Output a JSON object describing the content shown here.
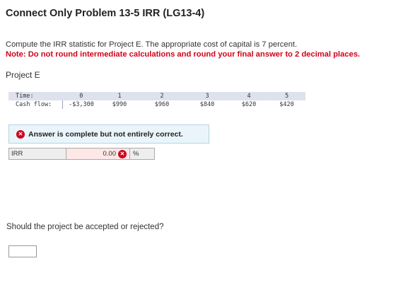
{
  "header": {
    "title": "Connect Only Problem 13-5 IRR (LG13-4)"
  },
  "instructions": {
    "prompt": "Compute the IRR statistic for Project E. The appropriate cost of capital is 7 percent.",
    "note": "Note: Do not round intermediate calculations and round your final answer to 2 decimal places."
  },
  "project": {
    "label": "Project E"
  },
  "cash_flow_table": {
    "time_label": "Time:",
    "cash_label": "Cash flow:",
    "times": [
      "0",
      "1",
      "2",
      "3",
      "4",
      "5"
    ],
    "cash_flows": [
      "-$3,300",
      "$990",
      "$960",
      "$840",
      "$620",
      "$420"
    ]
  },
  "feedback": {
    "message": "Answer is complete but not entirely correct.",
    "icon": "x-circle-icon",
    "color": "#d0021b"
  },
  "irr": {
    "label": "IRR",
    "value": "0.00",
    "unit": "%",
    "status": "incorrect"
  },
  "question": {
    "text": "Should the project be accepted or rejected?",
    "answer": ""
  }
}
